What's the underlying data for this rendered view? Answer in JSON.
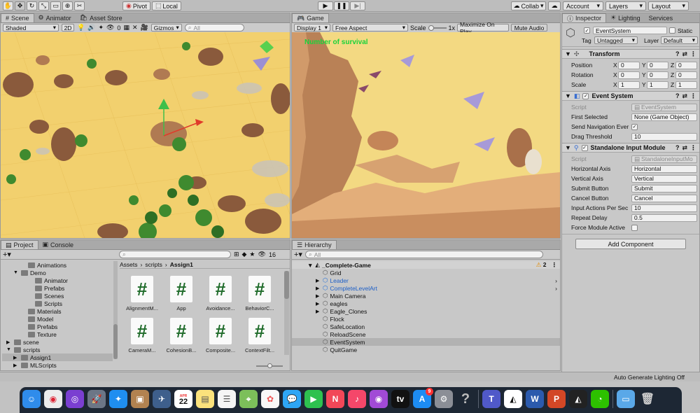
{
  "toolbar": {
    "pivot_label": "Pivot",
    "local_label": "Local",
    "collab_label": "Collab",
    "account_label": "Account",
    "layers_label": "Layers",
    "layout_label": "Layout"
  },
  "scene_panel": {
    "tabs": [
      "Scene",
      "Animator",
      "Asset Store"
    ],
    "shading_mode": "Shaded",
    "mode_2d": "2D",
    "hidden_count": "0",
    "gizmos_label": "Gizmos",
    "search_placeholder": "All"
  },
  "game_panel": {
    "tab": "Game",
    "display": "Display 1",
    "aspect": "Free Aspect",
    "scale_label": "Scale",
    "scale_value": "1x",
    "maximize_label": "Maximize On Play",
    "mute_label": "Mute Audio",
    "overlay_text": "Number of survival",
    "overlay_color": "#19d43a"
  },
  "inspector": {
    "tabs": [
      "Inspector",
      "Lighting",
      "Services"
    ],
    "object_name": "EventSystem",
    "static_label": "Static",
    "tag_label": "Tag",
    "tag_value": "Untagged",
    "layer_label": "Layer",
    "layer_value": "Default",
    "transform": {
      "title": "Transform",
      "rows": [
        {
          "label": "Position",
          "x": "0",
          "y": "0",
          "z": "0"
        },
        {
          "label": "Rotation",
          "x": "0",
          "y": "0",
          "z": "0"
        },
        {
          "label": "Scale",
          "x": "1",
          "y": "1",
          "z": "1"
        }
      ]
    },
    "event_system": {
      "title": "Event System",
      "script_label": "Script",
      "script_value": "EventSystem",
      "first_selected_label": "First Selected",
      "first_selected_value": "None (Game Object)",
      "send_nav_label": "Send Navigation Ever",
      "drag_label": "Drag Threshold",
      "drag_value": "10"
    },
    "standalone": {
      "title": "Standalone Input Module",
      "script_label": "Script",
      "script_value": "StandaloneInputMo",
      "rows": [
        {
          "label": "Horizontal Axis",
          "value": "Horizontal"
        },
        {
          "label": "Vertical Axis",
          "value": "Vertical"
        },
        {
          "label": "Submit Button",
          "value": "Submit"
        },
        {
          "label": "Cancel Button",
          "value": "Cancel"
        },
        {
          "label": "Input Actions Per Sec",
          "value": "10"
        },
        {
          "label": "Repeat Delay",
          "value": "0.5"
        }
      ],
      "force_label": "Force Module Active"
    },
    "add_component": "Add Component"
  },
  "project_panel": {
    "tabs": [
      "Project",
      "Console"
    ],
    "hidden_count": "16",
    "breadcrumb": [
      "Assets",
      "scripts",
      "Assign1"
    ],
    "tree": [
      {
        "label": "Animations",
        "indent": 2,
        "arrow": ""
      },
      {
        "label": "Demo",
        "indent": 1,
        "arrow": "▼"
      },
      {
        "label": "Animator",
        "indent": 3,
        "arrow": ""
      },
      {
        "label": "Prefabs",
        "indent": 3,
        "arrow": ""
      },
      {
        "label": "Scenes",
        "indent": 3,
        "arrow": ""
      },
      {
        "label": "Scripts",
        "indent": 3,
        "arrow": ""
      },
      {
        "label": "Materials",
        "indent": 2,
        "arrow": ""
      },
      {
        "label": "Model",
        "indent": 2,
        "arrow": ""
      },
      {
        "label": "Prefabs",
        "indent": 2,
        "arrow": ""
      },
      {
        "label": "Texture",
        "indent": 2,
        "arrow": ""
      },
      {
        "label": "scene",
        "indent": 0,
        "arrow": "▶"
      },
      {
        "label": "scripts",
        "indent": 0,
        "arrow": "▼"
      },
      {
        "label": "Assign1",
        "indent": 1,
        "arrow": "▶",
        "selected": true
      },
      {
        "label": "MLScripts",
        "indent": 1,
        "arrow": "▶"
      }
    ],
    "assets": [
      "AlignmentM...",
      "App",
      "Avoidance...",
      "BehaviorC...",
      "CameraM...",
      "CohesionB...",
      "Composite...",
      "ContextFilt..."
    ]
  },
  "hierarchy": {
    "tab": "Hierarchy",
    "search_placeholder": "All",
    "scene_name": "_Complete-Game",
    "scene_badge": "2",
    "items": [
      {
        "label": "Grid",
        "arrow": "",
        "prefab": false
      },
      {
        "label": "Leader",
        "arrow": "▶",
        "prefab": true
      },
      {
        "label": "CompleteLevelArt",
        "arrow": "▶",
        "prefab": true
      },
      {
        "label": "Main Camera",
        "arrow": "▶",
        "prefab": false
      },
      {
        "label": "eagles",
        "arrow": "▶",
        "prefab": false
      },
      {
        "label": "Eagle_Clones",
        "arrow": "▶",
        "prefab": false
      },
      {
        "label": "Flock",
        "arrow": "",
        "prefab": false
      },
      {
        "label": "SafeLocation",
        "arrow": "",
        "prefab": false
      },
      {
        "label": "ReloadScene",
        "arrow": "",
        "prefab": false
      },
      {
        "label": "EventSystem",
        "arrow": "",
        "prefab": false,
        "selected": true
      },
      {
        "label": "QuitGame",
        "arrow": "",
        "prefab": false
      }
    ]
  },
  "status_bar": {
    "text": "Auto Generate Lighting Off"
  },
  "dock": {
    "calendar_month": "APR",
    "calendar_day": "22",
    "badge_count": "9"
  }
}
